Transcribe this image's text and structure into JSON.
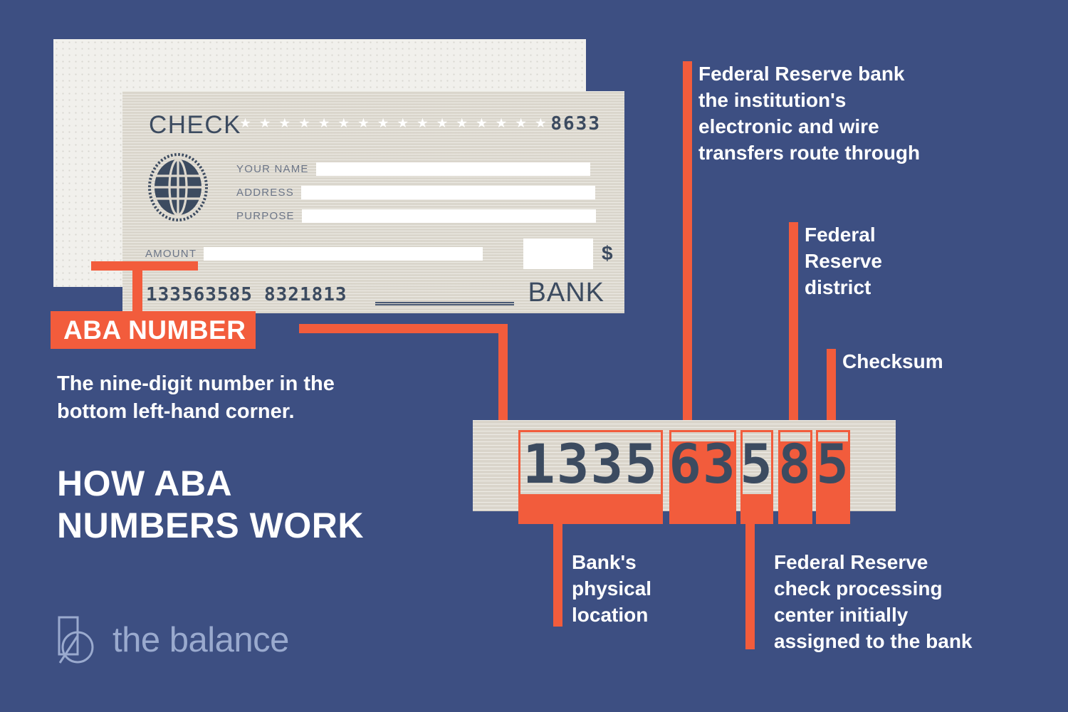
{
  "colors": {
    "background": "#3d4f82",
    "accent": "#f25c3c",
    "check_paper": "#ddd8ce",
    "ink": "#3c4b60",
    "white": "#ffffff",
    "logo": "#9aaace"
  },
  "check": {
    "title": "CHECK",
    "check_number": "8633",
    "star_count": 16,
    "fields": [
      {
        "label": "YOUR NAME",
        "value": ""
      },
      {
        "label": "ADDRESS",
        "value": ""
      },
      {
        "label": "PURPOSE",
        "value": ""
      }
    ],
    "amount_label": "AMOUNT",
    "amount_value": "",
    "cents_value": "",
    "currency_symbol": "$",
    "routing_number": "133563585",
    "account_number": "8321813",
    "bank_label": "BANK"
  },
  "callout": {
    "label": "ABA NUMBER",
    "description": "The nine-digit number in the\nbottom left-hand corner."
  },
  "title": "HOW ABA\nNUMBERS WORK",
  "logo": {
    "text": "the balance"
  },
  "chart_data": {
    "type": "diagram",
    "title": "HOW ABA NUMBERS WORK",
    "full_number": "133563585",
    "groups": [
      {
        "digits": "1335",
        "label": "Bank's\nphysical\nlocation",
        "side": "bottom"
      },
      {
        "digits": "63",
        "label": "Federal Reserve bank\nthe institution's\nelectronic and wire\ntransfers route through",
        "side": "top"
      },
      {
        "digits": "5",
        "label": "Federal Reserve\ncheck processing\ncenter initially\nassigned to the bank",
        "side": "bottom"
      },
      {
        "digits": "8",
        "label": "Federal\nReserve\ndistrict",
        "side": "top"
      },
      {
        "digits": "5",
        "label": "Checksum",
        "side": "top"
      }
    ]
  },
  "notes": {
    "federal_reserve_bank": "Federal Reserve bank\nthe institution's\nelectronic and wire\ntransfers route through",
    "federal_reserve_district": "Federal\nReserve\ndistrict",
    "checksum": "Checksum",
    "bank_location": "Bank's\nphysical\nlocation",
    "processing_center": "Federal Reserve\ncheck processing\ncenter initially\nassigned to the bank"
  }
}
